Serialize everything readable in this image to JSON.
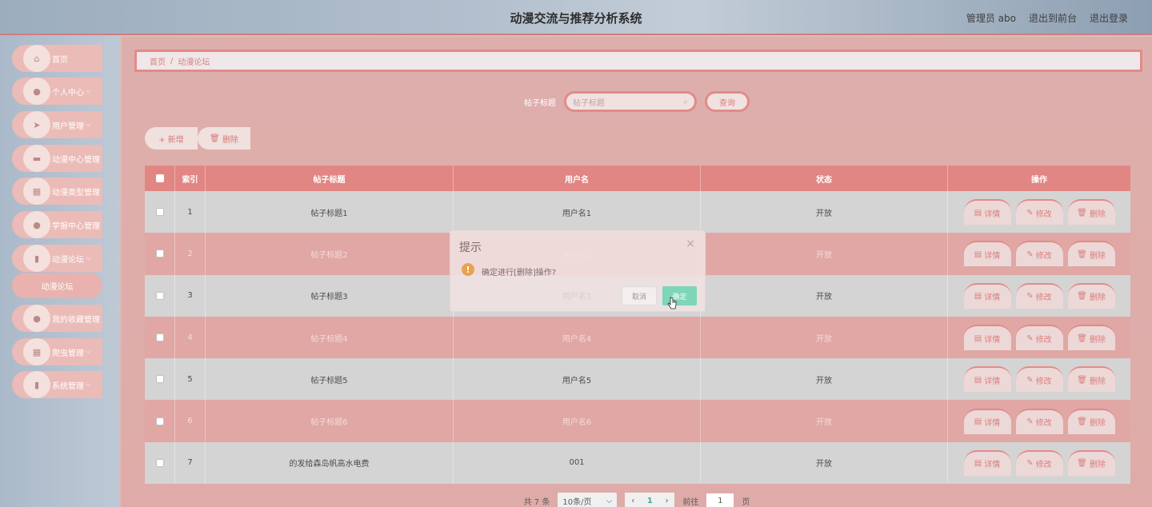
{
  "header": {
    "title": "动漫交流与推荐分析系统",
    "admin_label": "管理员 abo",
    "front_label": "退出到前台",
    "logout_label": "退出登录"
  },
  "sidebar": {
    "items": [
      {
        "label": "首页",
        "icon": "home-icon",
        "arrow": ""
      },
      {
        "label": "个人中心",
        "icon": "user-icon",
        "arrow": "⌵"
      },
      {
        "label": "用户管理",
        "icon": "send-icon",
        "arrow": "⌵"
      },
      {
        "label": "动漫中心管理",
        "icon": "monitor-icon",
        "arrow": ""
      },
      {
        "label": "动漫类型管理",
        "icon": "grid-icon",
        "arrow": ""
      },
      {
        "label": "学报中心管理",
        "icon": "user-icon",
        "arrow": ""
      },
      {
        "label": "动漫论坛",
        "icon": "chart-icon",
        "arrow": "⌵"
      },
      {
        "label": "我的收藏管理",
        "icon": "user-icon",
        "arrow": ""
      },
      {
        "label": "爬虫管理",
        "icon": "grid-icon",
        "arrow": "⌵"
      },
      {
        "label": "系统管理",
        "icon": "chart-icon",
        "arrow": "⌵"
      }
    ],
    "submenu_label": "动漫论坛"
  },
  "breadcrumb": {
    "home": "首页",
    "sep": "/",
    "current": "动漫论坛"
  },
  "search": {
    "label": "帖子标题",
    "placeholder": "帖子标题",
    "button": "查询"
  },
  "actions": {
    "add": "+ 新增",
    "delete": "删除"
  },
  "table": {
    "headers": {
      "index": "索引",
      "title": "帖子标题",
      "user": "用户名",
      "status": "状态",
      "ops": "操作"
    },
    "rows": [
      {
        "index": "1",
        "title": "帖子标题1",
        "user": "用户名1",
        "status": "开放"
      },
      {
        "index": "2",
        "title": "帖子标题2",
        "user": "用户名2",
        "status": "开放"
      },
      {
        "index": "3",
        "title": "帖子标题3",
        "user": "用户名3",
        "status": "开放"
      },
      {
        "index": "4",
        "title": "帖子标题4",
        "user": "用户名4",
        "status": "开放"
      },
      {
        "index": "5",
        "title": "帖子标题5",
        "user": "用户名5",
        "status": "开放"
      },
      {
        "index": "6",
        "title": "帖子标题6",
        "user": "用户名6",
        "status": "开放"
      },
      {
        "index": "7",
        "title": "的发给森岛帆高水电费",
        "user": "001",
        "status": "开放"
      }
    ],
    "ops": {
      "detail": "详情",
      "edit": "修改",
      "delete": "删除"
    }
  },
  "pager": {
    "total": "共 7 条",
    "size": "10条/页",
    "current": "1",
    "goto_label": "前往",
    "goto_value": "1",
    "page_unit": "页"
  },
  "dialog": {
    "title": "提示",
    "message": "确定进行[删除]操作?",
    "cancel": "取消",
    "ok": "确定"
  },
  "colors": {
    "accent": "#e07a78",
    "header_row": "#de7672",
    "confirm": "#7dd6b8",
    "warn": "#e9a24e"
  }
}
